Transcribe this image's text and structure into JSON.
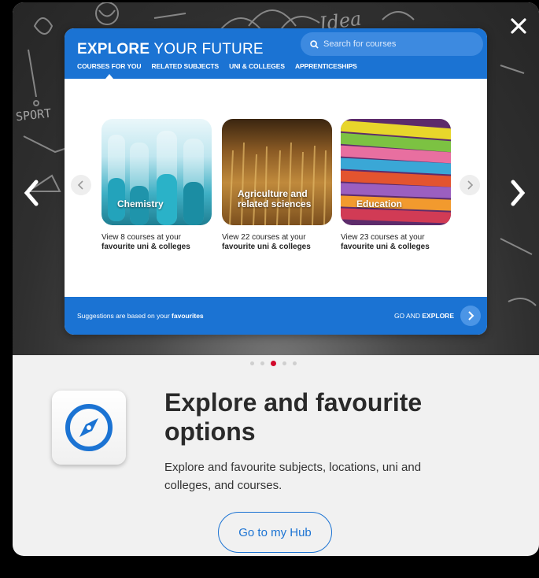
{
  "panel": {
    "title_bold": "EXPLORE",
    "title_rest": " YOUR FUTURE",
    "search_placeholder": "Search for courses",
    "tabs": [
      {
        "label": "COURSES FOR YOU",
        "active": true
      },
      {
        "label": "RELATED SUBJECTS",
        "active": false
      },
      {
        "label": "UNI & COLLEGES",
        "active": false
      },
      {
        "label": "APPRENTICESHIPS",
        "active": false
      }
    ],
    "cards": [
      {
        "label": "Chemistry",
        "desc_line1": "View 8 courses at your",
        "desc_line2": "favourite uni & colleges"
      },
      {
        "label": "Agriculture and related sciences",
        "desc_line1": "View 22 courses at your",
        "desc_line2": "favourite uni & colleges"
      },
      {
        "label": "Education",
        "desc_line1": "View 23 courses at your",
        "desc_line2": "favourite uni & colleges"
      }
    ],
    "footer_text": "Suggestions are based on your ",
    "footer_bold": "favourites",
    "go_explore_prefix": "GO AND ",
    "go_explore_bold": "EXPLORE"
  },
  "chalk_text": "SPORT",
  "chalk_word": "Idea",
  "carousel": {
    "total_slides": 5,
    "active_index": 2
  },
  "onboarding": {
    "icon": "compass-icon",
    "heading": "Explore and favourite options",
    "body": "Explore and favourite subjects, locations, uni and colleges, and courses.",
    "button_label": "Go to my Hub"
  },
  "colors": {
    "brand_blue": "#1b73d3",
    "active_dot": "#d2092b"
  }
}
